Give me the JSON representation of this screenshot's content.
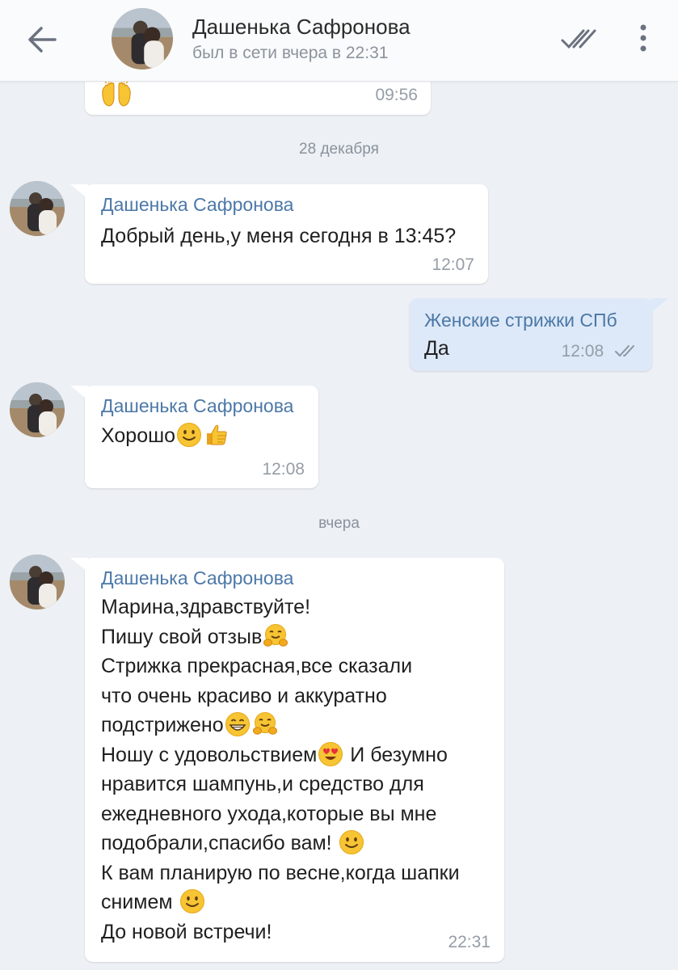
{
  "header": {
    "contact_name": "Дашенька Сафронова",
    "status": "был в сети вчера в 22:31",
    "back_icon": "arrow-left-icon",
    "read_icon": "double-check-icon",
    "menu_icon": "more-vertical-icon"
  },
  "colors": {
    "background": "#edf0f5",
    "incoming_bubble": "#ffffff",
    "outgoing_bubble": "#dde9f8",
    "sender_name": "#4c78a8",
    "meta_text": "#959da6"
  },
  "messages": [
    {
      "direction": "in",
      "text_lines": [
        ""
      ],
      "emoji": [
        "raising-hands-emoji"
      ],
      "time": "09:56"
    },
    {
      "type": "date",
      "label": "28 декабря"
    },
    {
      "direction": "in",
      "sender": "Дашенька Сафронова",
      "text_lines": [
        "Добрый день,у меня сегодня в 13:45?"
      ],
      "time": "12:07"
    },
    {
      "direction": "out",
      "sender": "Женские стрижки СПб",
      "text_lines": [
        "Да"
      ],
      "time": "12:08",
      "status": "read"
    },
    {
      "direction": "in",
      "sender": "Дашенька Сафронова",
      "text_lines": [
        "Хорошо"
      ],
      "emoji": [
        "slightly-smiling-face-emoji",
        "thumbs-up-emoji"
      ],
      "time": "12:08"
    },
    {
      "type": "date",
      "label": "вчера"
    },
    {
      "direction": "in",
      "sender": "Дашенька Сафронова",
      "text_lines": [
        "Марина,здравствуйте!",
        "Пишу свой отзыв",
        "Стрижка прекрасная,все сказали",
        "что очень красиво и аккуратно",
        "подстрижено",
        "Ношу с удовольствием",
        "И безумно",
        "нравится шампунь,и средство для",
        "ежедневного ухода,которые вы мне",
        "подобрали,спасибо вам!",
        "К вам планирую по весне,когда шапки",
        "снимем",
        "До новой встречи!"
      ],
      "time": "22:31"
    }
  ]
}
